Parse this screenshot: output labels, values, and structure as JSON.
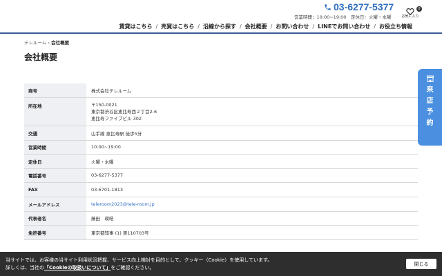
{
  "header": {
    "phone": "03-6277-5377",
    "hours_label": "営業時間：10:00~19:00",
    "closed_label": "定休日：火曜・水曜",
    "favorites": {
      "count": "0",
      "label": "お気に入り"
    }
  },
  "nav": {
    "items": [
      {
        "label": "賃貸はこちら"
      },
      {
        "label": "売買はこちら"
      },
      {
        "label": "沿線から探す"
      },
      {
        "label": "会社概要"
      },
      {
        "label": "お問い合わせ"
      },
      {
        "label": "LINEでお問い合わせ"
      },
      {
        "label": "お役立ち情報"
      }
    ],
    "separator": "/"
  },
  "breadcrumb": {
    "home": "テレルーム",
    "separator": "›",
    "current": "会社概要"
  },
  "page_title": "会社概要",
  "company_table": {
    "trade_name": {
      "label": "商号",
      "value": "株式会社テレルーム"
    },
    "address": {
      "label": "所在地",
      "postal": "〒150-0021",
      "line1": "東京都渋谷区恵比寿西２丁目2-6",
      "line2": "恵比寿ファイブビル 302"
    },
    "access": {
      "label": "交通",
      "value": "山手線 恵比寿駅 徒歩5分"
    },
    "hours": {
      "label": "営業時間",
      "value": "10:00~19:00"
    },
    "holiday": {
      "label": "定休日",
      "value": "火曜・水曜"
    },
    "phone": {
      "label": "電話番号",
      "value": "03-6277-5377"
    },
    "fax": {
      "label": "FAX",
      "value": "03-6701-1813"
    },
    "email": {
      "label": "メールアドレス",
      "value": "teleroom2023@tele-room.jp"
    },
    "representative": {
      "label": "代表者名",
      "value": "藤田　瑛皓"
    },
    "license": {
      "label": "免許番号",
      "value": "東京都知事 (1) 第110703号"
    }
  },
  "reserve_tab": {
    "chars": [
      "来",
      "店",
      "予",
      "約"
    ]
  },
  "cookie": {
    "line1": "当サイトでは、お客様の当サイト利用状況把握、サービス向上検討を目的として、クッキー（Cookie）を使用しています。",
    "line2_prefix": "詳しくは、当社の",
    "link_text": "「Cookieの取扱いについて」",
    "line2_suffix": "をご確認ください。",
    "close_label": "閉じる"
  },
  "colors": {
    "accent": "#2f6fc0",
    "nav_border": "#3a5a96",
    "reserve_bg": "#4a8fe0",
    "label_bg": "#eef0f3"
  }
}
